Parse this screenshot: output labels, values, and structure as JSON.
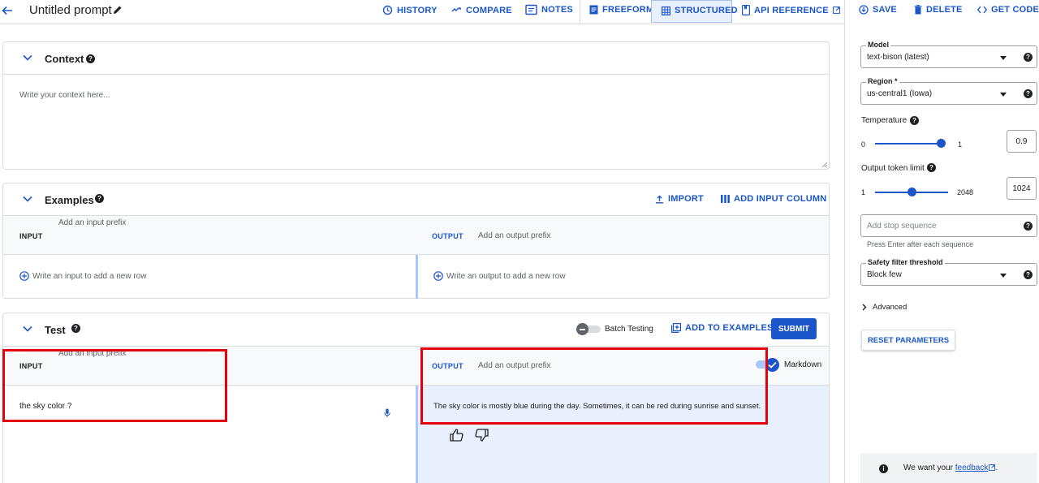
{
  "header": {
    "title": "Untitled prompt",
    "history": "HISTORY",
    "compare": "COMPARE",
    "notes": "NOTES",
    "freeform": "FREEFORM",
    "structured": "STRUCTURED",
    "api_reference": "API REFERENCE",
    "save": "SAVE",
    "delete": "DELETE",
    "get_code": "GET CODE"
  },
  "context": {
    "title": "Context",
    "placeholder": "Write your context here..."
  },
  "examples": {
    "title": "Examples",
    "import": "IMPORT",
    "add_input_column": "ADD INPUT COLUMN",
    "input_prefix_placeholder": "Add an input prefix",
    "input_label": "INPUT",
    "output_label": "OUTPUT",
    "output_prefix_placeholder": "Add an output prefix",
    "input_row_placeholder": "Write an input to add a new row",
    "output_row_placeholder": "Write an output to add a new row"
  },
  "test": {
    "title": "Test",
    "batch_testing": "Batch Testing",
    "add_to_examples": "ADD TO EXAMPLES",
    "submit": "SUBMIT",
    "input_prefix_placeholder": "Add an input prefix",
    "input_label": "INPUT",
    "output_label": "OUTPUT",
    "output_prefix_placeholder": "Add an output prefix",
    "markdown": "Markdown",
    "input_value": "the sky color ?",
    "output_value": "The sky color is mostly blue during the day. Sometimes, it can be red during sunrise and sunset."
  },
  "params": {
    "model_label": "Model",
    "model_value": "text-bison (latest)",
    "region_label": "Region *",
    "region_value": "us-central1 (Iowa)",
    "temperature_label": "Temperature",
    "temperature_min": "0",
    "temperature_max": "1",
    "temperature_value": "0.9",
    "temperature_fraction": 0.9,
    "token_label": "Output token limit",
    "token_min": "1",
    "token_max": "2048",
    "token_value": "1024",
    "token_fraction": 0.5,
    "stop_placeholder": "Add stop sequence",
    "stop_hint": "Press Enter after each sequence",
    "safety_label": "Safety filter threshold",
    "safety_value": "Block few",
    "advanced": "Advanced",
    "reset": "RESET PARAMETERS",
    "feedback_prefix": "We want your",
    "feedback_link": "feedback",
    "feedback_suffix": "."
  },
  "colors": {
    "accent": "#1a56c9",
    "highlight_red": "#e3000f",
    "output_bg": "#e8f0fe"
  }
}
